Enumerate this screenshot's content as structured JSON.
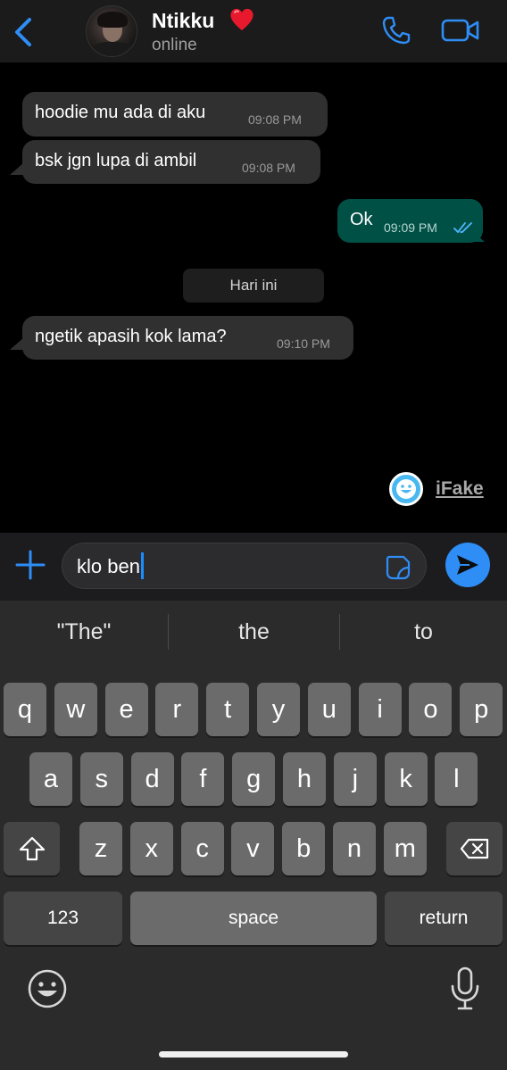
{
  "header": {
    "contact_name": "Ntikku",
    "contact_emoji": "❤️",
    "status": "online",
    "colors": {
      "accent": "#2e8ef6",
      "background": "#1b1b1b"
    }
  },
  "messages": [
    {
      "direction": "in",
      "text": "hoodie mu ada di aku",
      "time": "09:08 PM"
    },
    {
      "direction": "in",
      "text": "bsk jgn lupa di ambil",
      "time": "09:08 PM"
    },
    {
      "direction": "out",
      "text": "Ok",
      "time": "09:09 PM",
      "read_receipt": "double-check-icon"
    }
  ],
  "date_separator": "Hari ini",
  "messages_after": [
    {
      "direction": "in",
      "text": "ngetik apasih kok lama?",
      "time": "09:10 PM"
    }
  ],
  "watermark": {
    "label": "iFake"
  },
  "composer": {
    "value": "klo ben"
  },
  "keyboard": {
    "suggestions": [
      "\"The\"",
      "the",
      "to"
    ],
    "row1": [
      "q",
      "w",
      "e",
      "r",
      "t",
      "y",
      "u",
      "i",
      "o",
      "p"
    ],
    "row2": [
      "a",
      "s",
      "d",
      "f",
      "g",
      "h",
      "j",
      "k",
      "l"
    ],
    "row3": [
      "z",
      "x",
      "c",
      "v",
      "b",
      "n",
      "m"
    ],
    "numbers_label": "123",
    "space_label": "space",
    "return_label": "return"
  },
  "colors": {
    "incoming_bubble": "#303030",
    "outgoing_bubble": "#005046",
    "send_button": "#2e8ef6"
  }
}
